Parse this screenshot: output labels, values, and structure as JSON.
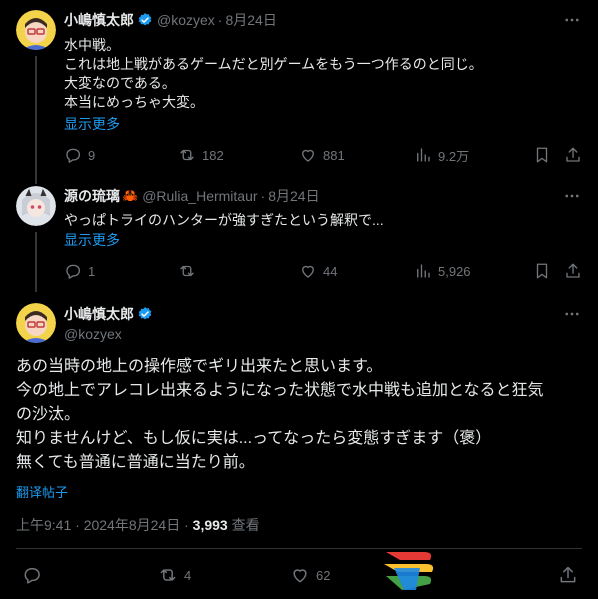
{
  "reply1": {
    "author_name": "小嶋慎太郎",
    "handle": "@kozyex",
    "date": "8月24日",
    "lines": [
      "水中戦。",
      "これは地上戦があるゲームだと別ゲームをもう一つ作るのと同じ。",
      "大変なのである。",
      "本当にめっちゃ大変。"
    ],
    "show_more": "显示更多",
    "stats": {
      "replies": "9",
      "reposts": "182",
      "likes": "881",
      "views": "9.2万"
    }
  },
  "reply2": {
    "author_name": "源の琉璃",
    "emoji": "🦀",
    "handle": "@Rulia_Hermitaur",
    "date": "8月24日",
    "lines": [
      "やっぱトライのハンターが強すぎたという解釈で..."
    ],
    "show_more": "显示更多",
    "stats": {
      "replies": "1",
      "reposts": "",
      "likes": "44",
      "views": "5,926"
    }
  },
  "main": {
    "author_name": "小嶋慎太郎",
    "handle": "@kozyex",
    "lines": [
      "あの当時の地上の操作感でギリ出来たと思います。",
      "今の地上でアレコレ出来るようになった状態で水中戦も追加となると狂気",
      "の沙汰。",
      "知りませんけど、もし仮に実は...ってなったら変態すぎます（褒）",
      "無くても普通に普通に当たり前。"
    ],
    "translate": "翻译帖子",
    "time": "上午9:41",
    "date": "2024年8月24日",
    "views_count": "3,993",
    "views_label": "查看",
    "stats": {
      "reposts": "4",
      "likes": "62"
    }
  },
  "colors": {
    "accent": "#1d9bf0",
    "muted": "#71767b",
    "bg": "#000000"
  },
  "icons": [
    "reply-icon",
    "repost-icon",
    "like-icon",
    "views-icon",
    "bookmark-icon",
    "share-icon",
    "verified-icon",
    "more-icon"
  ]
}
